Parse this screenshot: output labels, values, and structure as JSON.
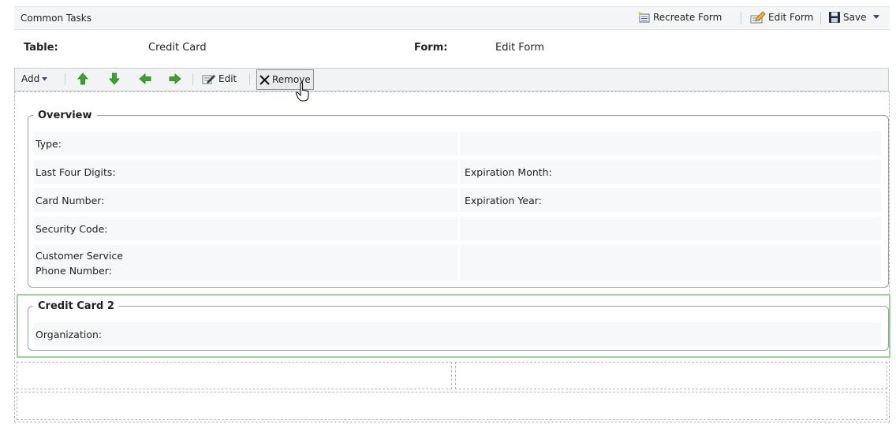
{
  "common_tasks": {
    "title": "Common Tasks",
    "recreate_label": "Recreate Form",
    "edit_label": "Edit Form",
    "save_label": "Save"
  },
  "header": {
    "table_label": "Table:",
    "table_value": "Credit Card",
    "form_label": "Form:",
    "form_value": "Edit Form"
  },
  "toolbar": {
    "add_label": "Add",
    "edit_label": "Edit",
    "remove_label": "Remove"
  },
  "sections": [
    {
      "title": "Overview",
      "rows": [
        {
          "left": "Type:",
          "right": ""
        },
        {
          "left": "Last Four Digits:",
          "right": "Expiration Month:"
        },
        {
          "left": "Card Number:",
          "right": "Expiration Year:"
        },
        {
          "left": "Security Code:",
          "right": ""
        },
        {
          "left": "Customer Service Phone Number:",
          "right": ""
        }
      ]
    },
    {
      "title": "Credit Card 2",
      "rows": [
        {
          "left": "Organization:"
        }
      ]
    }
  ],
  "colors": {
    "arrow_green": "#3aa52a",
    "selected_border": "#9ed19a",
    "save_icon": "#1f2a44"
  }
}
